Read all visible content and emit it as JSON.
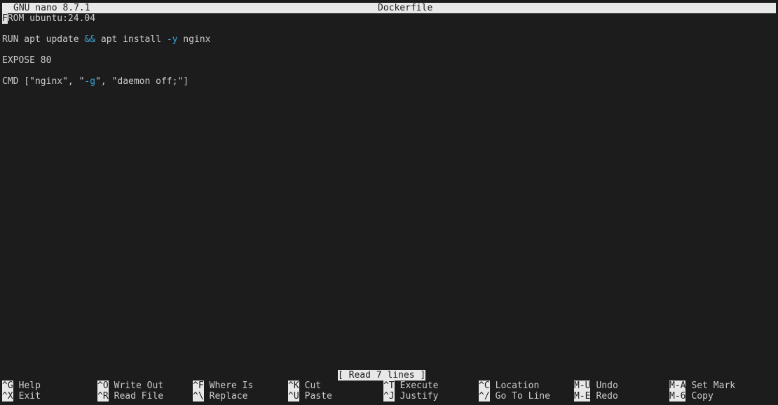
{
  "title_bar": {
    "app_version": "GNU nano 8.7.1",
    "filename": "Dockerfile"
  },
  "editor": {
    "cursor_char": "F",
    "line1_rest": "ROM ubuntu:24.04",
    "line3": {
      "a": "RUN apt update ",
      "op1": "&&",
      "b": " apt install ",
      "op2": "-y",
      "c": " nginx"
    },
    "line5": "EXPOSE 80",
    "line7": {
      "a": "CMD [\"nginx\", \"",
      "op": "-g",
      "b": "\", \"daemon off;\"]"
    }
  },
  "status_message": "[ Read 7 lines ]",
  "shortcuts": [
    {
      "key": "^G",
      "label": "Help"
    },
    {
      "key": "^X",
      "label": "Exit"
    },
    {
      "key": "^O",
      "label": "Write Out"
    },
    {
      "key": "^R",
      "label": "Read File"
    },
    {
      "key": "^F",
      "label": "Where Is"
    },
    {
      "key": "^\\",
      "label": "Replace"
    },
    {
      "key": "^K",
      "label": "Cut"
    },
    {
      "key": "^U",
      "label": "Paste"
    },
    {
      "key": "^T",
      "label": "Execute"
    },
    {
      "key": "^J",
      "label": "Justify"
    },
    {
      "key": "^C",
      "label": "Location"
    },
    {
      "key": "^/",
      "label": "Go To Line"
    },
    {
      "key": "M-U",
      "label": "Undo"
    },
    {
      "key": "M-E",
      "label": "Redo"
    },
    {
      "key": "M-A",
      "label": "Set Mark"
    },
    {
      "key": "M-6",
      "label": "Copy"
    }
  ],
  "colors": {
    "background": "#1c1c1c",
    "foreground": "#cccccc",
    "inverse_background": "#e8e8e8",
    "operator": "#3aa3d8"
  }
}
